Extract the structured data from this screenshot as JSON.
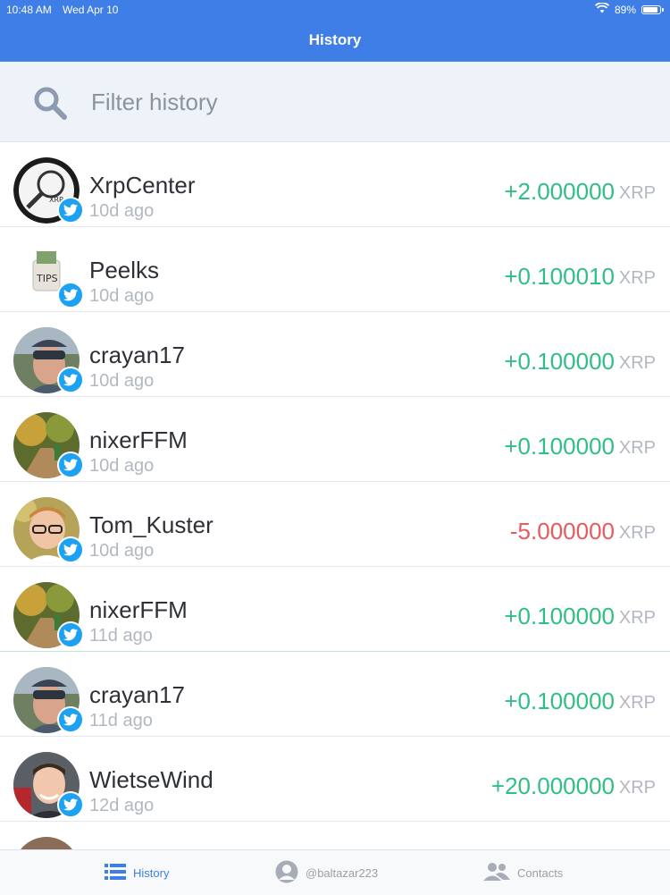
{
  "status_bar": {
    "time": "10:48 AM",
    "date": "Wed Apr 10",
    "battery": "89%"
  },
  "nav": {
    "title": "History"
  },
  "search": {
    "placeholder": "Filter history"
  },
  "history": [
    {
      "name": "XrpCenter",
      "time": "10d ago",
      "amount": "+2.000000",
      "currency": "XRP",
      "sign": "pos",
      "avatar": "magnifier-logo"
    },
    {
      "name": "Peelks",
      "time": "10d ago",
      "amount": "+0.100010",
      "currency": "XRP",
      "sign": "pos",
      "avatar": "tips-jar"
    },
    {
      "name": "crayan17",
      "time": "10d ago",
      "amount": "+0.100000",
      "currency": "XRP",
      "sign": "pos",
      "avatar": "man-cap-sunglasses"
    },
    {
      "name": "nixerFFM",
      "time": "10d ago",
      "amount": "+0.100000",
      "currency": "XRP",
      "sign": "pos",
      "avatar": "forest-path"
    },
    {
      "name": "Tom_Kuster",
      "time": "10d ago",
      "amount": "-5.000000",
      "currency": "XRP",
      "sign": "neg",
      "avatar": "man-glasses"
    },
    {
      "name": "nixerFFM",
      "time": "11d ago",
      "amount": "+0.100000",
      "currency": "XRP",
      "sign": "pos",
      "avatar": "forest-path"
    },
    {
      "name": "crayan17",
      "time": "11d ago",
      "amount": "+0.100000",
      "currency": "XRP",
      "sign": "pos",
      "avatar": "man-cap-sunglasses"
    },
    {
      "name": "WietseWind",
      "time": "12d ago",
      "amount": "+20.000000",
      "currency": "XRP",
      "sign": "pos",
      "avatar": "man-smiling"
    }
  ],
  "tabs": [
    {
      "label": "History",
      "icon": "list-icon",
      "active": true
    },
    {
      "label": "@baltazar223",
      "icon": "user-icon",
      "active": false
    },
    {
      "label": "Contacts",
      "icon": "contacts-icon",
      "active": false
    }
  ],
  "colors": {
    "accent": "#3f7ee6",
    "positive": "#2fbf84",
    "negative": "#e85a5e",
    "twitter": "#1da1f2"
  }
}
